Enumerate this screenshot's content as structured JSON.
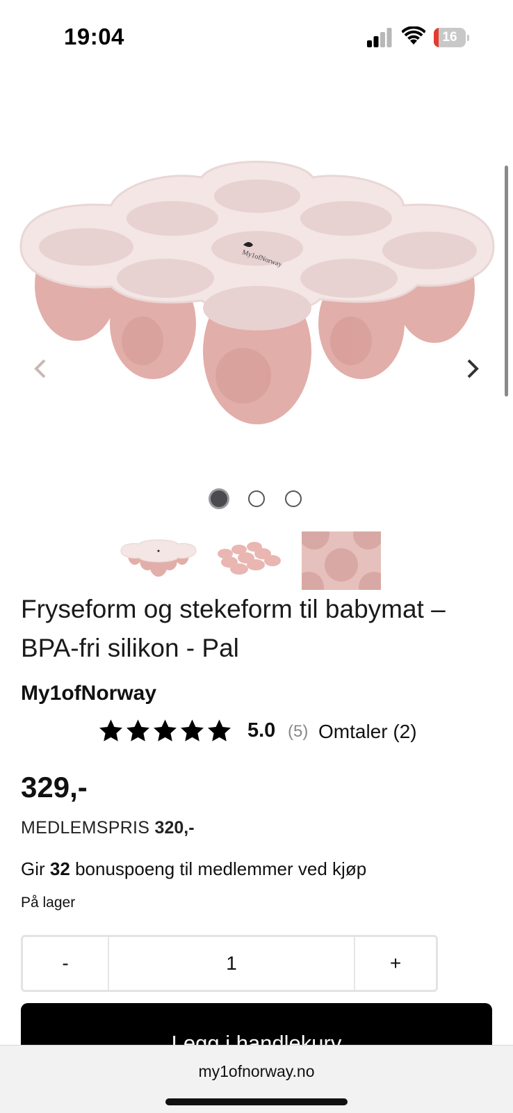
{
  "status_bar": {
    "time": "19:04",
    "battery_level": "16",
    "battery_fraction": 0.16,
    "icons": [
      "signal-icon",
      "wifi-icon",
      "battery-icon"
    ]
  },
  "gallery": {
    "icons": [
      "chevron-left-icon",
      "chevron-right-icon"
    ],
    "active_dot": 0,
    "dot_count": 3,
    "thumbnail_count": 3
  },
  "product": {
    "title": "Fryseform og stekeform til babymat – BPA-fri silikon - Pal",
    "brand": "My1ofNorway",
    "rating": {
      "stars": 5,
      "value": "5.0",
      "count": "(5)",
      "reviews_link": "Omtaler (2)"
    },
    "price": "329,-",
    "member_price_label": "MEDLEMSPRIS",
    "member_price": "320,-",
    "bonus_prefix": "Gir",
    "bonus_points": "32",
    "bonus_suffix": "bonuspoeng til medlemmer ved kjøp",
    "stock": "På lager"
  },
  "quantity": {
    "minus": "-",
    "value": "1",
    "plus": "+"
  },
  "cart": {
    "button_label": "Legg i handlekurv"
  },
  "browser": {
    "url": "my1ofnorway.no"
  },
  "colors": {
    "accent": "#000000",
    "product_pink": "#e3b1ac",
    "lid": "#f5e9e8",
    "battery_low": "#e53a2f"
  }
}
